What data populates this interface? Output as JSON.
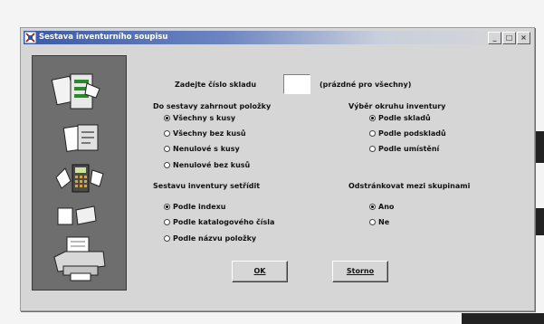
{
  "window": {
    "title": "Sestava inventurního soupisu",
    "title_buttons": [
      "_",
      "□",
      "×"
    ]
  },
  "sklad": {
    "label": "Zadejte číslo skladu",
    "value": "",
    "hint": "(prázdné pro všechny)"
  },
  "zahrnout": {
    "label": "Do sestavy zahrnout položky",
    "options": [
      "Všechny s kusy",
      "Všechny bez kusů",
      "Nenulové s kusy",
      "Nenulové bez kusů"
    ],
    "selected_index": 0
  },
  "rozsah": {
    "label": "Výběr okruhu inventury",
    "options": [
      "Podle skladů",
      "Podle podskladů",
      "Podle umístění"
    ],
    "selected_index": 0
  },
  "setridit": {
    "label": "Sestavu inventury setřídit",
    "options": [
      "Podle indexu",
      "Podle katalogového čísla",
      "Podle názvu položky"
    ],
    "selected_index": 0
  },
  "odstrankovat": {
    "label": "Odstránkovat mezi skupinami",
    "options": [
      "Ano",
      "Ne"
    ],
    "selected_index": 0
  },
  "buttons": {
    "ok": "OK",
    "cancel": "Storno"
  },
  "colors": {
    "title_start": "#3a59a8",
    "window_bg": "#d6d6d6",
    "side_panel": "#6e6e6e"
  }
}
